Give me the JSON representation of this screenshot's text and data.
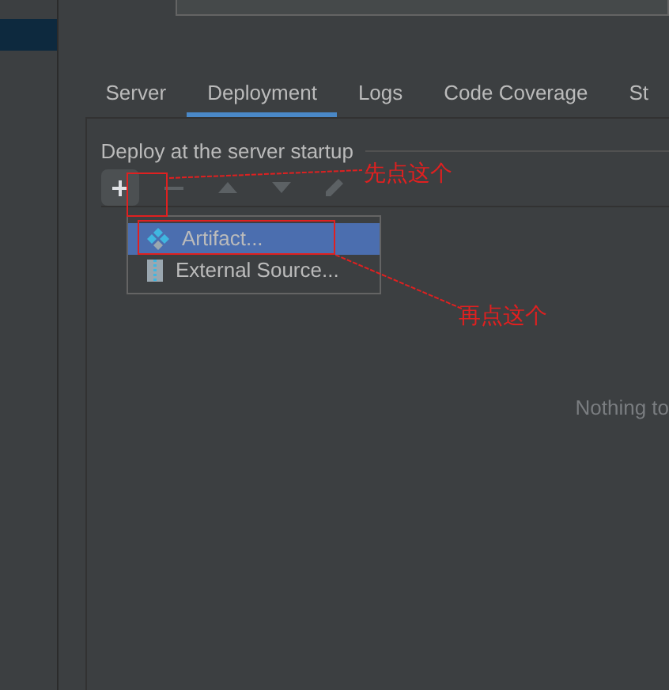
{
  "sidebar": {
    "items": [
      {
        "selected": true
      }
    ]
  },
  "tabs": [
    {
      "label": "Server",
      "selected": false
    },
    {
      "label": "Deployment",
      "selected": true
    },
    {
      "label": "Logs",
      "selected": false
    },
    {
      "label": "Code Coverage",
      "selected": false
    },
    {
      "label": "St",
      "selected": false
    }
  ],
  "deploy": {
    "title": "Deploy at the server startup",
    "toolbar": [
      {
        "kind": "add",
        "disabled": false
      },
      {
        "kind": "remove",
        "disabled": true
      },
      {
        "kind": "up",
        "disabled": true
      },
      {
        "kind": "down",
        "disabled": true
      },
      {
        "kind": "edit",
        "disabled": true
      }
    ],
    "empty_text": "Nothing to"
  },
  "popup": {
    "items": [
      {
        "label": "Artifact...",
        "kind": "artifact",
        "selected": true
      },
      {
        "label": "External Source...",
        "kind": "external",
        "selected": false
      }
    ]
  },
  "annotations": [
    {
      "text": "先点这个"
    },
    {
      "text": "再点这个"
    }
  ]
}
